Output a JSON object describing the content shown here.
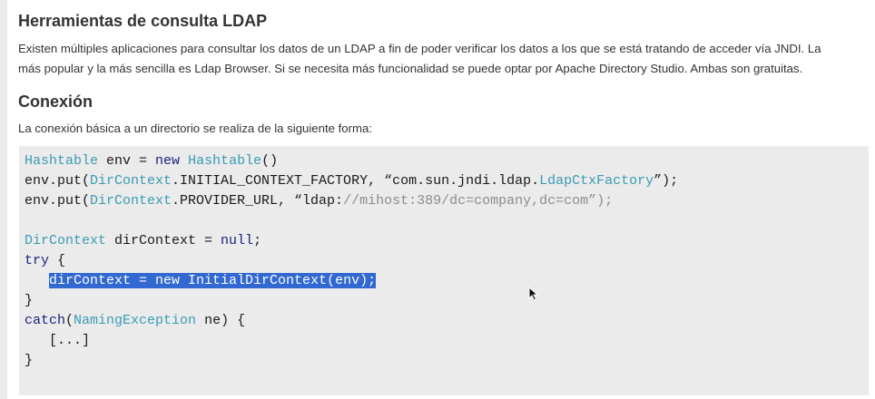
{
  "section1": {
    "title": "Herramientas de consulta LDAP",
    "paragraph_line1": "Existen múltiples aplicaciones para consultar los datos de un LDAP a fin de poder verificar los datos a los que se está tratando de acceder vía JNDI. La",
    "paragraph_line2": "más popular y la más sencilla es Ldap Browser. Si se necesita más funcionalidad se puede optar por Apache Directory Studio. Ambas son gratuitas."
  },
  "section2": {
    "title": "Conexión",
    "paragraph": "La conexión básica a un directorio se realiza de la siguiente forma:"
  },
  "code": {
    "line1": {
      "t1": "Hashtable",
      "t2": " env = ",
      "t3": "new",
      "t4": " ",
      "t5": "Hashtable",
      "t6": "()"
    },
    "line2": {
      "t1": "env.put(",
      "t2": "DirContext",
      "t3": ".INITIAL_CONTEXT_FACTORY, “com.sun.jndi.ldap.",
      "t4": "LdapCtxFactory",
      "t5": "”);"
    },
    "line3": {
      "t1": "env.put(",
      "t2": "DirContext",
      "t3": ".PROVIDER_URL, “ldap:",
      "t4": "//mihost:389/dc=company,dc=com”);"
    },
    "line5": {
      "t1": "DirContext",
      "t2": " dirContext = ",
      "t3": "null",
      "t4": ";"
    },
    "line6": {
      "t1": "try",
      "t2": " {"
    },
    "line7": {
      "indent": "   ",
      "selected": "dirContext = new InitialDirContext(env);"
    },
    "line8": {
      "t1": "}"
    },
    "line9": {
      "t1": "catch",
      "t2": "(",
      "t3": "NamingException",
      "t4": " ne) {"
    },
    "line10": {
      "t1": "   [...]"
    },
    "line11": {
      "t1": "}"
    }
  },
  "colors": {
    "type": "#3a9bb5",
    "keyword": "#1a237e",
    "string_comment": "#8c8c8c",
    "selection": "#3168d1",
    "code_background": "#ebebeb"
  },
  "icons": {
    "cursor": "mouse-pointer-icon"
  }
}
